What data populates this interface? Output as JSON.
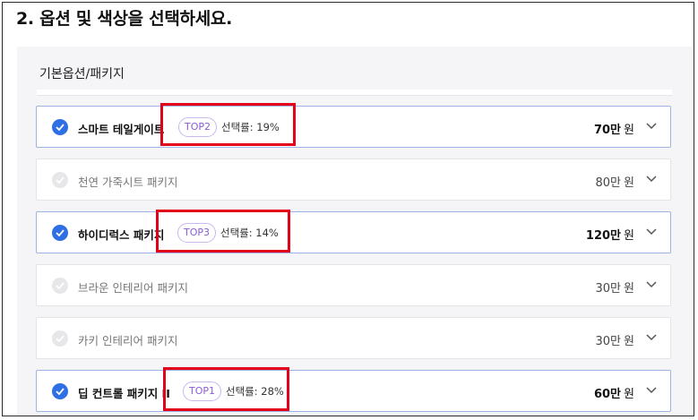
{
  "heading": "2. 옵션 및 색상을 선택하세요.",
  "section_title": "기본옵션/패키지",
  "options": [
    {
      "label": "스마트 테일게이트",
      "selected": true,
      "badge": "TOP2",
      "rate": "선택률: 19%",
      "price_num": "70만",
      "price_unit": "원"
    },
    {
      "label": "천연 가죽시트 패키지",
      "selected": false,
      "badge": "",
      "rate": "",
      "price_num": "80만",
      "price_unit": "원"
    },
    {
      "label": "하이디럭스 패키지",
      "selected": true,
      "badge": "TOP3",
      "rate": "선택률: 14%",
      "price_num": "120만",
      "price_unit": "원"
    },
    {
      "label": "브라운 인테리어 패키지",
      "selected": false,
      "badge": "",
      "rate": "",
      "price_num": "30만",
      "price_unit": "원"
    },
    {
      "label": "카키 인테리어 패키지",
      "selected": false,
      "badge": "",
      "rate": "",
      "price_num": "30만",
      "price_unit": "원"
    },
    {
      "label": "딥 컨트롤 패키지 II",
      "selected": true,
      "badge": "TOP1",
      "rate": "선택률: 28%",
      "price_num": "60만",
      "price_unit": "원"
    }
  ],
  "colors": {
    "accent": "#2f6fe4",
    "badge": "#8a5cd6",
    "highlight": "#e3001b"
  }
}
